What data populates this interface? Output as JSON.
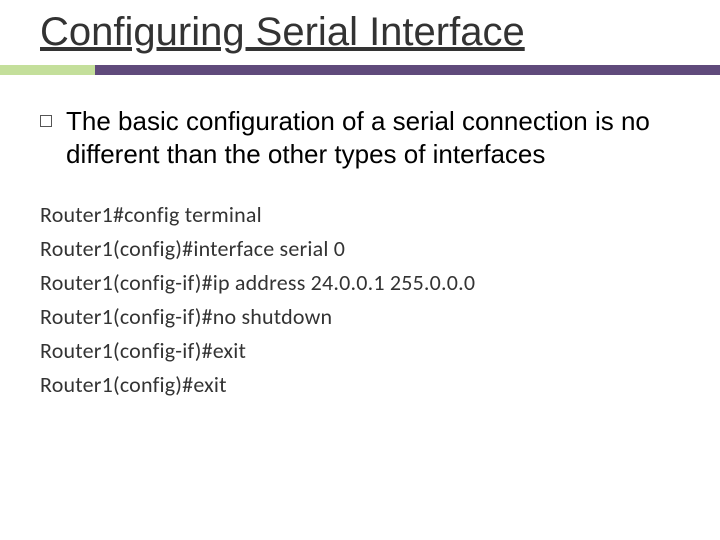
{
  "title": "Configuring Serial Interface",
  "bullet": "The basic configuration of a serial connection is no different than the other types of interfaces",
  "terminal": {
    "l0": "Router1#config terminal",
    "l1": "Router1(config)#interface serial 0",
    "l2": "Router1(config-if)#ip address 24.0.0.1 255.0.0.0",
    "l3": "Router1(config-if)#no shutdown",
    "l4": "Router1(config-if)#exit",
    "l5": "Router1(config)#exit"
  }
}
